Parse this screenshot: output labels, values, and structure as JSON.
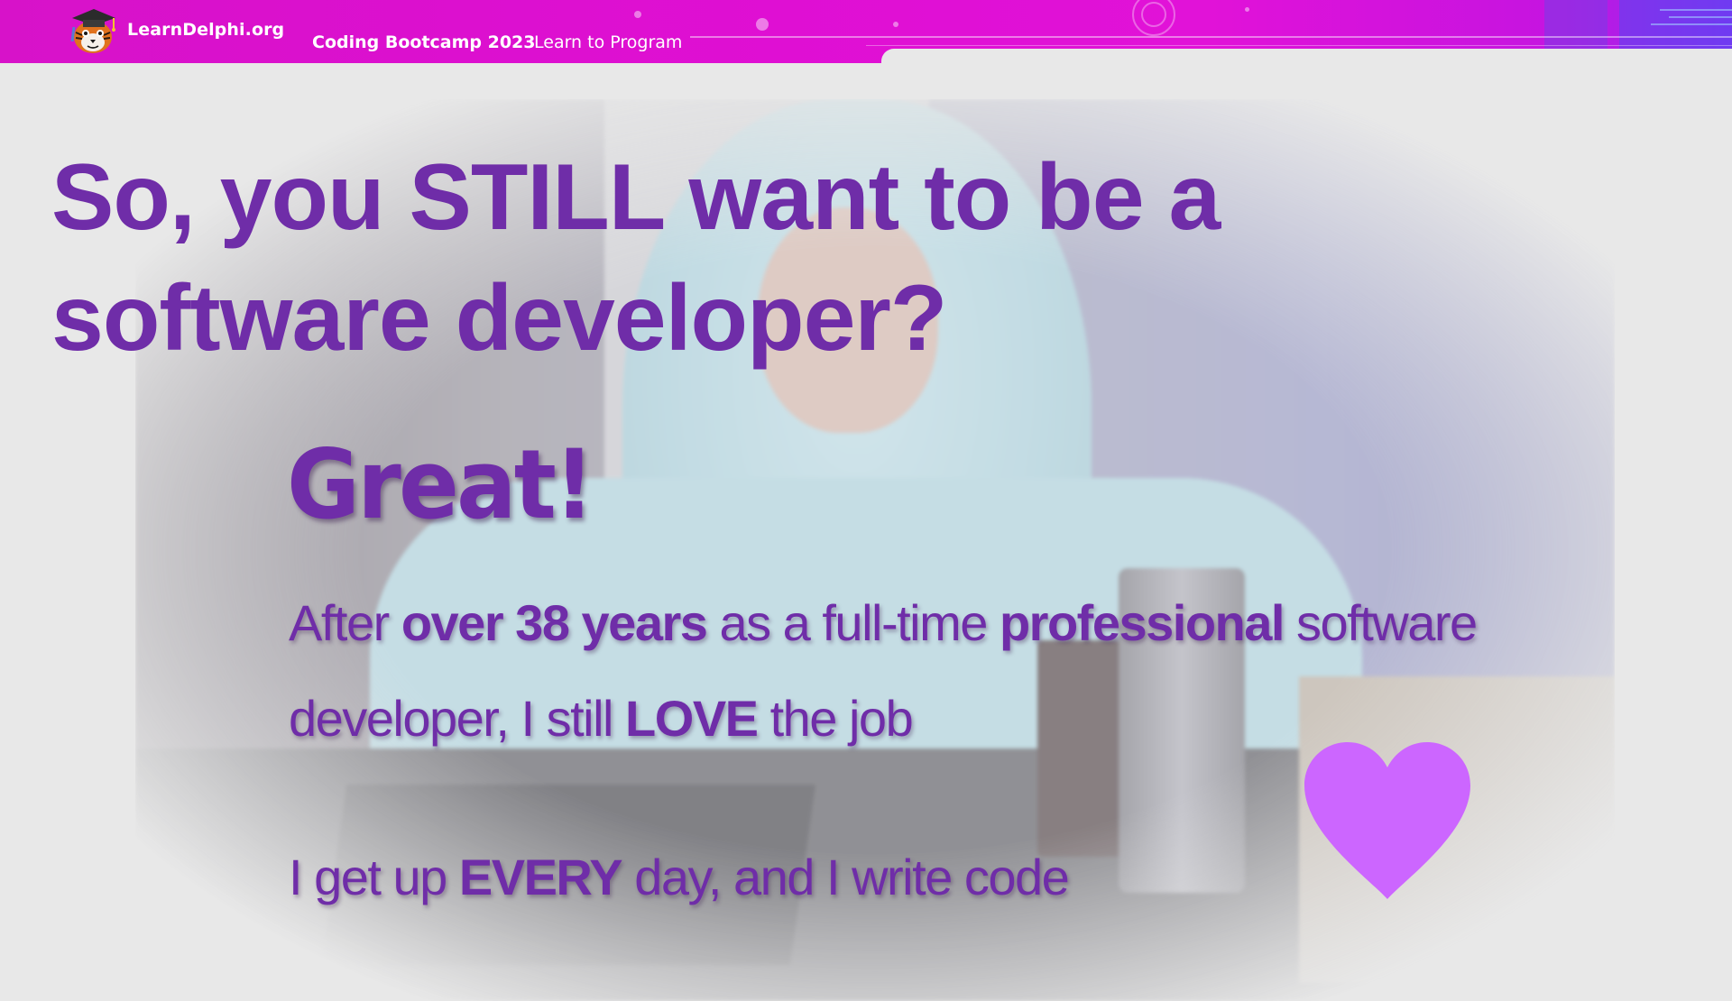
{
  "header": {
    "brand": "LearnDelphi.org",
    "course_title": "Coding Bootcamp 2023",
    "course_subtitle": "Learn to Program"
  },
  "slide": {
    "headline": "So, you STILL want to be a software developer?",
    "exclamation": "Great!",
    "paragraph_1": {
      "t1": "After ",
      "b1": "over 38 years",
      "t2": " as a full-time ",
      "b2": "professional",
      "t3": " software developer, I still ",
      "b3": "LOVE",
      "t4": " the job"
    },
    "paragraph_2": {
      "t1": "I get up ",
      "b1": "EVERY",
      "t2": " day, and I write code"
    }
  },
  "colors": {
    "banner": "#e010d6",
    "text_purple": "#6f2da8",
    "heart": "#cc66ff",
    "background": "#e8e8e8"
  },
  "icons": {
    "logo": "tiger-graduate-logo-icon",
    "heart": "heart-icon"
  }
}
